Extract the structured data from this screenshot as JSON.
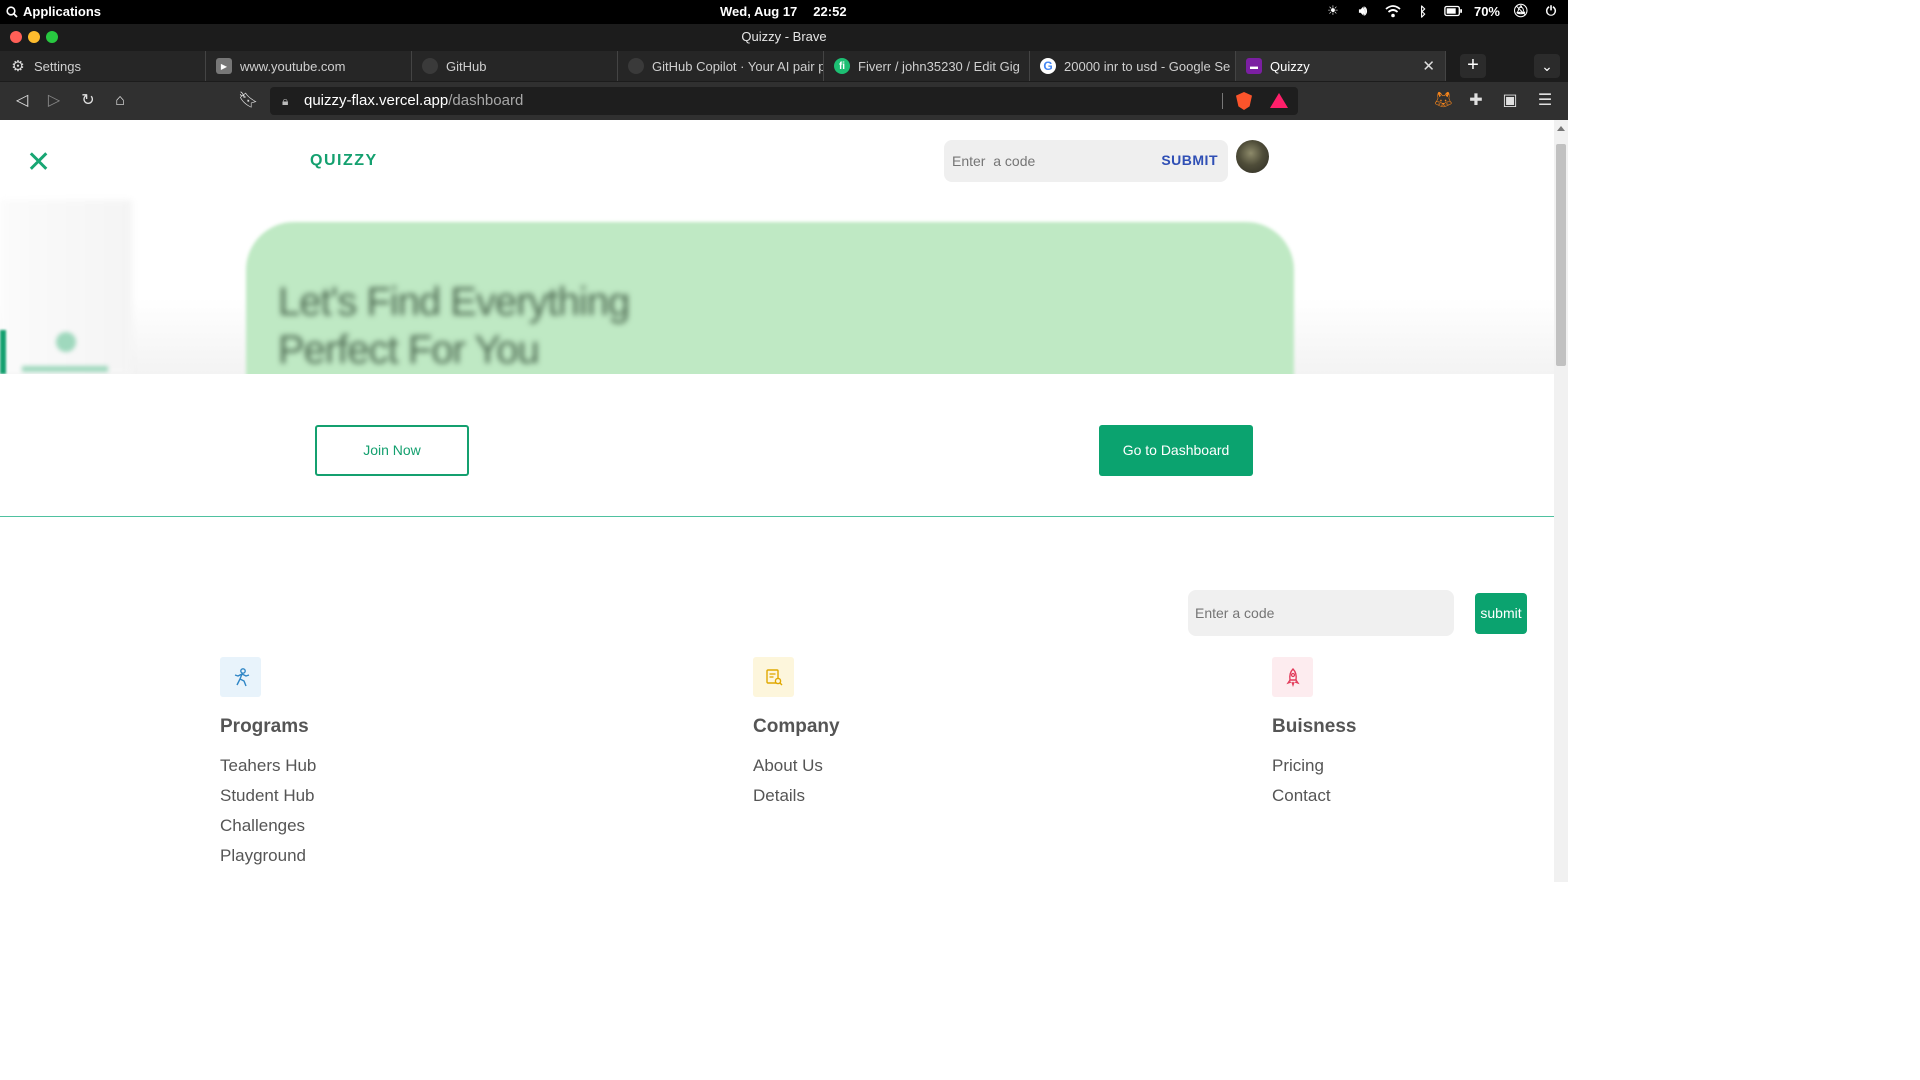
{
  "system": {
    "apps_label": "Applications",
    "date": "Wed, Aug 17",
    "time": "22:52",
    "battery": "70%"
  },
  "window": {
    "title": "Quizzy - Brave"
  },
  "tabs": [
    {
      "label": "Settings",
      "icon": "gear-icon"
    },
    {
      "label": "www.youtube.com",
      "icon": "youtube-icon"
    },
    {
      "label": "GitHub",
      "icon": "github-icon"
    },
    {
      "label": "GitHub Copilot · Your AI pair p",
      "icon": "github-icon"
    },
    {
      "label": "Fiverr / john35230 / Edit Gig",
      "icon": "fiverr-icon"
    },
    {
      "label": "20000 inr to usd - Google Se",
      "icon": "google-icon"
    },
    {
      "label": "Quizzy",
      "icon": "quizzy-icon",
      "active": true
    }
  ],
  "address": {
    "host": "quizzy-flax.vercel.app",
    "path": "/dashboard"
  },
  "header": {
    "brand": "QUIZZY",
    "code_placeholder": "Enter  a code",
    "submit_label": "SUBMIT"
  },
  "hero": {
    "line1": "Let's Find Everything",
    "line2": "Perfect For You"
  },
  "cta": {
    "join_label": "Join Now",
    "dashboard_label": "Go to Dashboard"
  },
  "footer": {
    "code_placeholder": "Enter a code",
    "submit_label": "submit",
    "columns": [
      {
        "title": "Programs",
        "links": [
          "Teahers Hub",
          "Student Hub",
          "Challenges",
          "Playground"
        ]
      },
      {
        "title": "Company",
        "links": [
          "About Us",
          "Details"
        ]
      },
      {
        "title": "Buisness",
        "links": [
          "Pricing",
          "Contact"
        ]
      }
    ]
  },
  "colors": {
    "brand_green": "#0ba36f",
    "hero_card": "#bfe9c4",
    "submit_blue": "#2f4fb5"
  }
}
